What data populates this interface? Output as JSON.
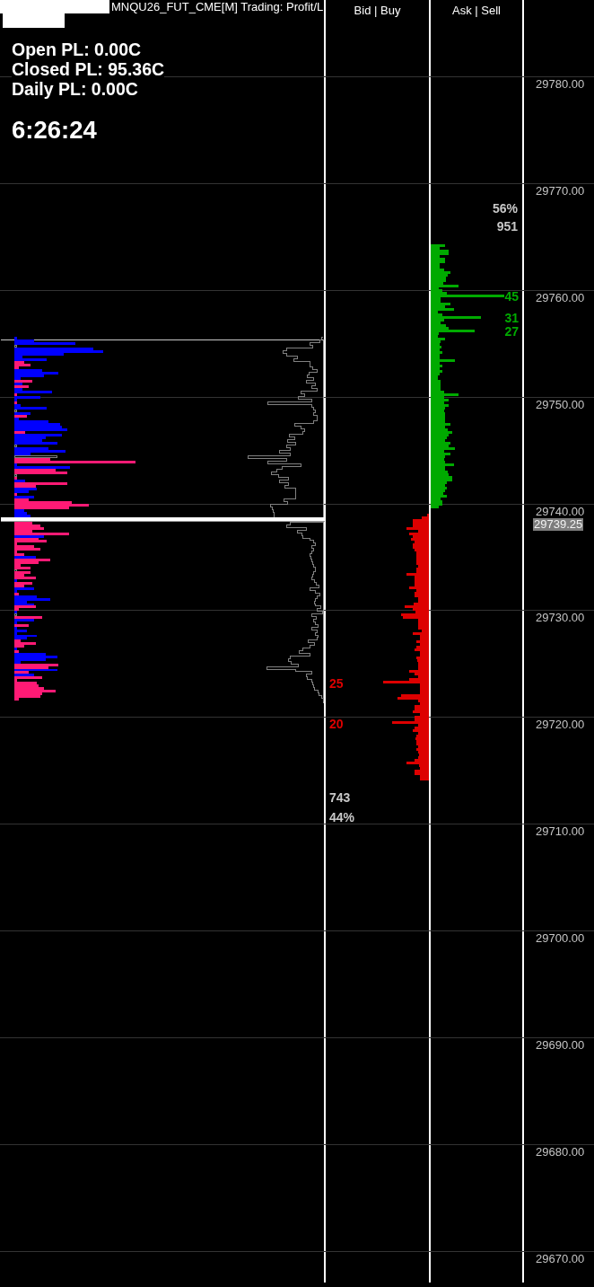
{
  "header": {
    "title": "MNQU26_FUT_CME[M] Trading: Profit/L"
  },
  "columns": [
    {
      "label": "Bid | Buy"
    },
    {
      "label": "Ask | Sell"
    }
  ],
  "pnl_lines": [
    "Open PL: 0.00C",
    "Closed PL: 95.36C",
    "Daily PL: 0.00C"
  ],
  "clock": "6:26:24",
  "price_axis": {
    "labels": [
      "29780.00",
      "29770.00",
      "29760.00",
      "29750.00",
      "29740.00",
      "29730.00",
      "29720.00",
      "29710.00",
      "29700.00",
      "29690.00",
      "29680.00",
      "29670.00"
    ],
    "last_price": "29739.25"
  },
  "ask_side": {
    "percent": "56%",
    "total": "951",
    "volume_labels": [
      "45",
      "31",
      "27"
    ]
  },
  "bid_side": {
    "volume_labels": [
      "25",
      "20"
    ],
    "total": "743",
    "percent": "44%"
  }
}
